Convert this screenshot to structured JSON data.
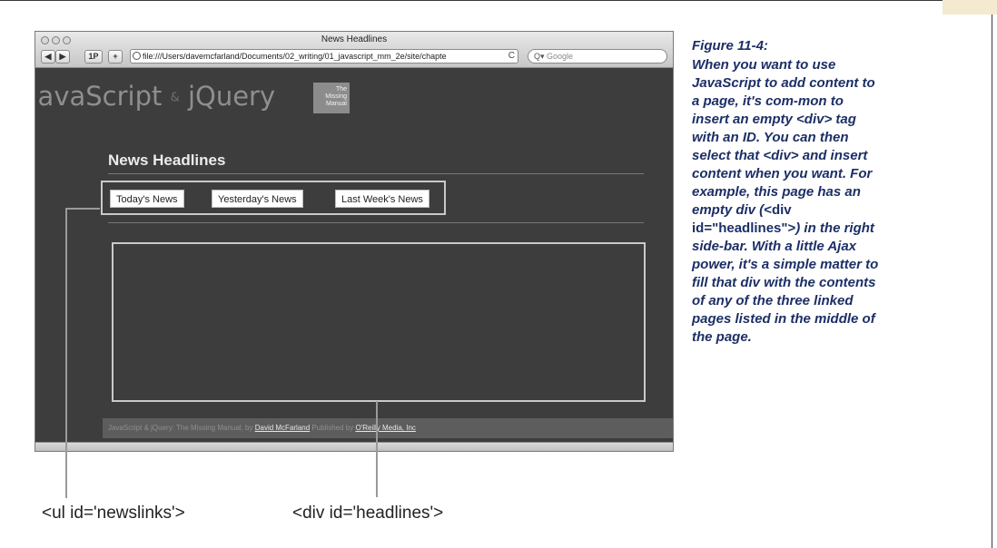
{
  "browser": {
    "window_title": "News Headlines",
    "url": "file:///Users/davemcfarland/Documents/02_writing/01_javascript_mm_2e/site/chapte",
    "search_placeholder": "Google",
    "back_label": "◀",
    "forward_label": "▶",
    "onep_label": "1P",
    "add_label": "+",
    "reload_icon": "reload-icon"
  },
  "site": {
    "logo_left": "JavaScript",
    "logo_amp": "&",
    "logo_right": "jQuery",
    "badge_lines": [
      "The",
      "Missing",
      "Manual"
    ],
    "headline": "News Headlines",
    "nav": [
      "Today's News",
      "Yesterday's News",
      "Last Week's News"
    ],
    "footer_prefix": "JavaScript & jQuery: The Missing Manual, by",
    "footer_author": "David McFarland",
    "footer_mid": "Published by",
    "footer_publisher": "O'Reilly Media, Inc"
  },
  "callouts": {
    "newslinks": "<ul id='newslinks'>",
    "headlines": "<div id='headlines'>"
  },
  "caption": {
    "title": "Figure 11-4:",
    "part1": "When you want to use JavaScript to add content to a page, it's com-mon to insert an empty <div> tag with an ID. You can then select that <div> and insert content when you want. For example, this page has an empty div (",
    "code": "<div id=\"headlines\">",
    "part2": ") in the right side-bar. With a little Ajax power, it's a simple matter to fill that div with the contents of any of the three linked pages listed in the middle of the page."
  },
  "colors": {
    "caption": "#1c2f66",
    "site_bg": "#3d3d3d",
    "highlight_border": "#c9c9c9"
  }
}
